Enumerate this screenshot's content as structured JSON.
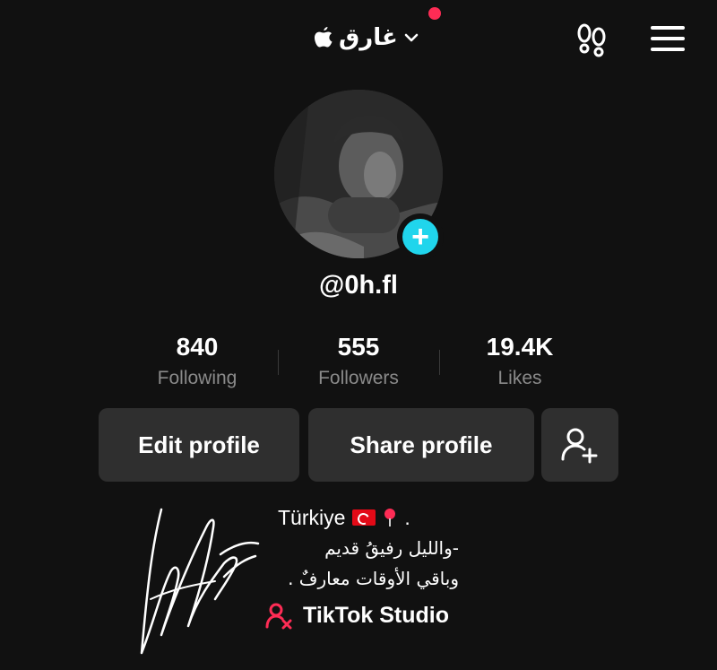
{
  "header": {
    "username": "غارق",
    "icons": [
      "apple-icon",
      "chevron-down-icon",
      "notification-dot",
      "footprint-icon",
      "menu-icon"
    ],
    "notification_color": "#fe2c55"
  },
  "profile": {
    "handle": "@0h.fl",
    "avatar_badge": "+",
    "badge_color": "#20d5ec"
  },
  "stats": [
    {
      "value": "840",
      "label": "Following"
    },
    {
      "value": "555",
      "label": "Followers"
    },
    {
      "value": "19.4K",
      "label": "Likes"
    }
  ],
  "buttons": {
    "edit_label": "Edit profile",
    "share_label": "Share profile",
    "add_friend_icon": "add-user-icon"
  },
  "bio": {
    "location": "Türkiye",
    "location_suffix": ".",
    "line2": "-والليل رفيقُ قديم",
    "line3": "وباقي الأوقات معارفٌ ."
  },
  "studio": {
    "label": "TikTok Studio",
    "icon": "creator-icon",
    "icon_color": "#fe2c55"
  },
  "colors": {
    "background": "#111111",
    "button": "#2f2f2f",
    "secondary_text": "#8a8a8a"
  }
}
